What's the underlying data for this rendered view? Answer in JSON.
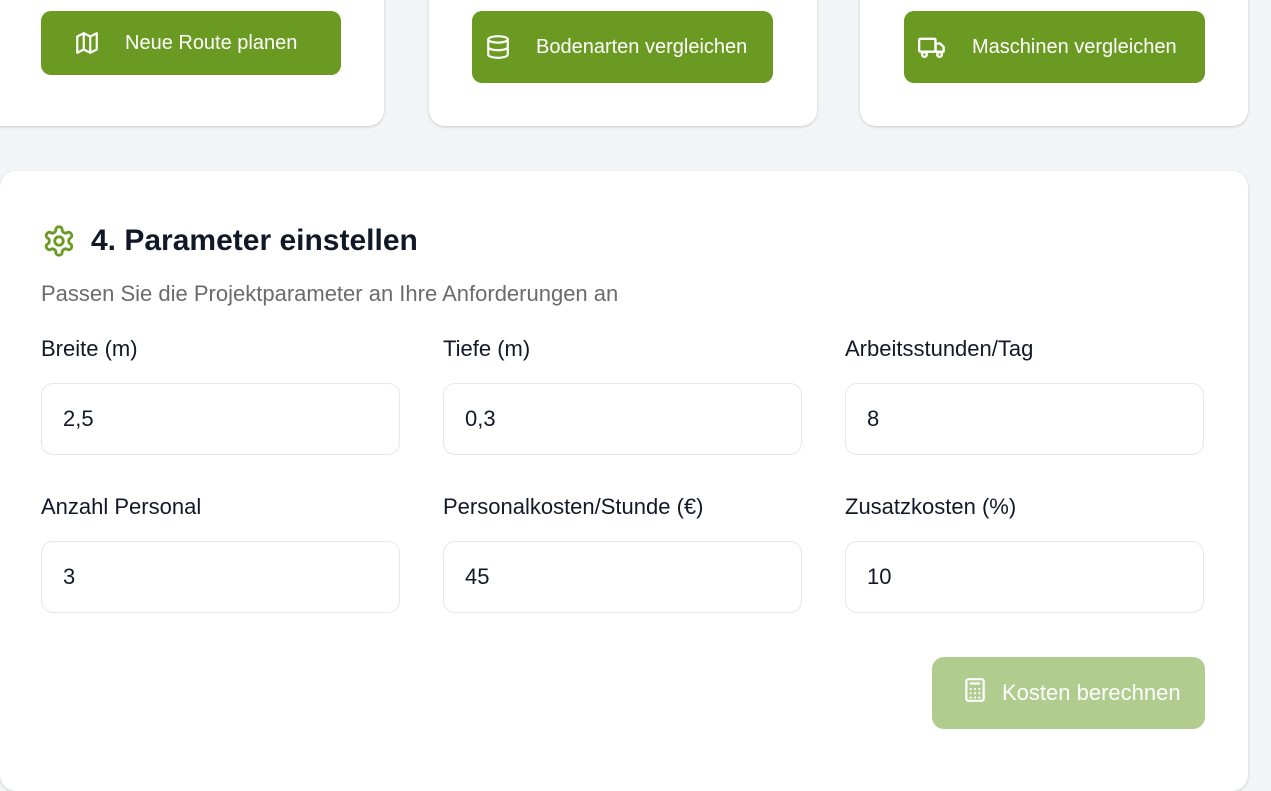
{
  "actions": {
    "route_label": "Neue Route planen",
    "soil_label": "Bodenarten vergleichen",
    "machines_label": "Maschinen vergleichen",
    "route_icon": "map-icon",
    "soil_icon": "database-icon",
    "machines_icon": "truck-icon"
  },
  "section": {
    "title": "4. Parameter einstellen",
    "subtitle": "Passen Sie die Projektparameter an Ihre Anforderungen an",
    "icon": "gear-icon"
  },
  "fields": {
    "breite": {
      "label": "Breite (m)",
      "value": "2,5"
    },
    "tiefe": {
      "label": "Tiefe (m)",
      "value": "0,3"
    },
    "arbeitsstunden": {
      "label": "Arbeitsstunden/Tag",
      "value": "8"
    },
    "personal": {
      "label": "Anzahl Personal",
      "value": "3"
    },
    "personalkosten": {
      "label": "Personalkosten/Stunde (€)",
      "value": "45"
    },
    "zusatzkosten": {
      "label": "Zusatzkosten (%)",
      "value": "10"
    }
  },
  "calculate": {
    "label": "Kosten berechnen",
    "icon": "calculator-icon"
  },
  "colors": {
    "primary": "#6b9a22",
    "primary_disabled": "#b1cc8f",
    "background": "#f3f4f6",
    "card": "#ffffff"
  }
}
